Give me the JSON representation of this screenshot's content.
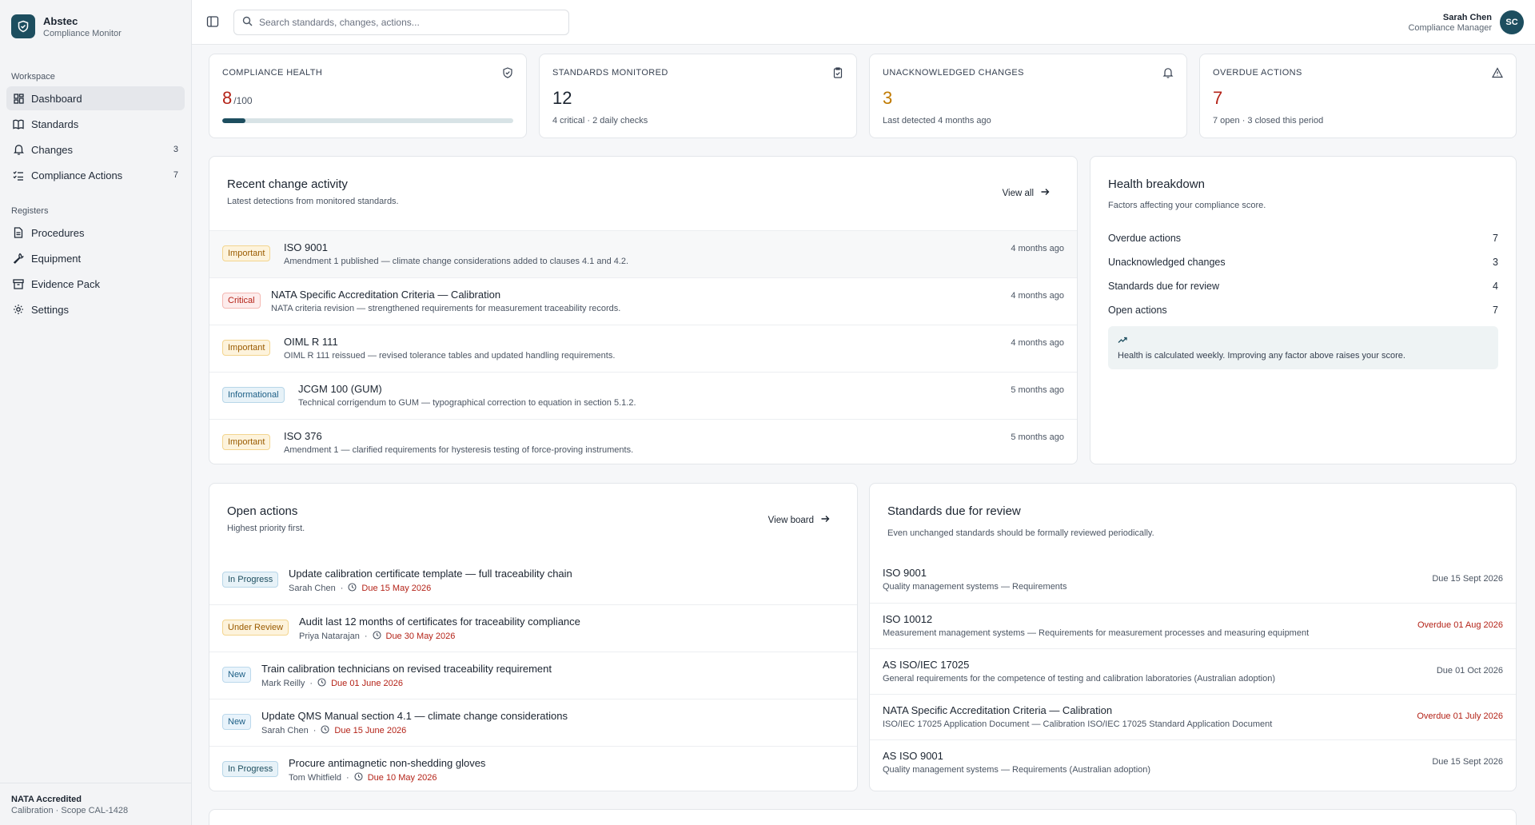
{
  "brand": {
    "name": "Abstec",
    "subtitle": "Compliance Monitor"
  },
  "sidebar": {
    "workspace_label": "Workspace",
    "workspace_items": [
      {
        "label": "Dashboard",
        "icon": "dashboard-icon",
        "count": ""
      },
      {
        "label": "Standards",
        "icon": "book-icon",
        "count": ""
      },
      {
        "label": "Changes",
        "icon": "bell-icon",
        "count": "3"
      },
      {
        "label": "Compliance Actions",
        "icon": "checklist-icon",
        "count": "7"
      }
    ],
    "registers_label": "Registers",
    "register_items": [
      {
        "label": "Procedures",
        "icon": "document-icon"
      },
      {
        "label": "Equipment",
        "icon": "wrench-icon"
      },
      {
        "label": "Evidence Pack",
        "icon": "archive-icon"
      },
      {
        "label": "Settings",
        "icon": "gear-icon"
      }
    ],
    "footer": {
      "title": "NATA Accredited",
      "subtitle": "Calibration · Scope CAL-1428"
    }
  },
  "search": {
    "placeholder": "Search standards, changes, actions..."
  },
  "user": {
    "name": "Sarah Chen",
    "role": "Compliance Manager",
    "initials": "SC"
  },
  "stats": {
    "health": {
      "label": "COMPLIANCE HEALTH",
      "value": "8",
      "unit": "/100",
      "progress": 0.08
    },
    "standards": {
      "label": "STANDARDS MONITORED",
      "value": "12",
      "sub": "4 critical · 2 daily checks"
    },
    "unack": {
      "label": "UNACKNOWLEDGED CHANGES",
      "value": "3",
      "sub": "Last detected 4 months ago"
    },
    "overdue": {
      "label": "OVERDUE ACTIONS",
      "value": "7",
      "sub": "7 open · 3 closed this period"
    }
  },
  "recent": {
    "title": "Recent change activity",
    "subtitle": "Latest detections from monitored standards.",
    "view_all": "View all",
    "items": [
      {
        "badge": "Important",
        "title": "ISO 9001",
        "desc": "Amendment 1 published — climate change considerations added to clauses 4.1 and 4.2.",
        "time": "4 months ago"
      },
      {
        "badge": "Critical",
        "title": "NATA Specific Accreditation Criteria — Calibration",
        "desc": "NATA criteria revision — strengthened requirements for measurement traceability records.",
        "time": "4 months ago"
      },
      {
        "badge": "Important",
        "title": "OIML R 111",
        "desc": "OIML R 111 reissued — revised tolerance tables and updated handling requirements.",
        "time": "4 months ago"
      },
      {
        "badge": "Informational",
        "title": "JCGM 100 (GUM)",
        "desc": "Technical corrigendum to GUM — typographical correction to equation in section 5.1.2.",
        "time": "5 months ago"
      },
      {
        "badge": "Important",
        "title": "ISO 376",
        "desc": "Amendment 1 — clarified requirements for hysteresis testing of force-proving instruments.",
        "time": "5 months ago"
      }
    ]
  },
  "health_breakdown": {
    "title": "Health breakdown",
    "subtitle": "Factors affecting your compliance score.",
    "rows": [
      {
        "label": "Overdue actions",
        "value": "7"
      },
      {
        "label": "Unacknowledged changes",
        "value": "3"
      },
      {
        "label": "Standards due for review",
        "value": "4"
      },
      {
        "label": "Open actions",
        "value": "7"
      }
    ],
    "note": "Health is calculated weekly. Improving any factor above raises your score."
  },
  "open_actions": {
    "title": "Open actions",
    "subtitle": "Highest priority first.",
    "view_board": "View board",
    "items": [
      {
        "badge": "In Progress",
        "title": "Update calibration certificate template — full traceability chain",
        "owner": "Sarah Chen",
        "due": "Due 15 May 2026"
      },
      {
        "badge": "Under Review",
        "title": "Audit last 12 months of certificates for traceability compliance",
        "owner": "Priya Natarajan",
        "due": "Due 30 May 2026"
      },
      {
        "badge": "New",
        "title": "Train calibration technicians on revised traceability requirement",
        "owner": "Mark Reilly",
        "due": "Due 01 June 2026"
      },
      {
        "badge": "New",
        "title": "Update QMS Manual section 4.1 — climate change considerations",
        "owner": "Sarah Chen",
        "due": "Due 15 June 2026"
      },
      {
        "badge": "In Progress",
        "title": "Procure antimagnetic non-shedding gloves",
        "owner": "Tom Whitfield",
        "due": "Due 10 May 2026"
      }
    ]
  },
  "review": {
    "title": "Standards due for review",
    "subtitle": "Even unchanged standards should be formally reviewed periodically.",
    "items": [
      {
        "title": "ISO 9001",
        "desc": "Quality management systems — Requirements",
        "due": "Due 15 Sept 2026",
        "overdue": false
      },
      {
        "title": "ISO 10012",
        "desc": "Measurement management systems — Requirements for measurement processes and measuring equipment",
        "due": "Overdue 01 Aug 2026",
        "overdue": true
      },
      {
        "title": "AS ISO/IEC 17025",
        "desc": "General requirements for the competence of testing and calibration laboratories (Australian adoption)",
        "due": "Due 01 Oct 2026",
        "overdue": false
      },
      {
        "title": "NATA Specific Accreditation Criteria — Calibration",
        "desc": "ISO/IEC 17025 Application Document — Calibration ISO/IEC 17025 Standard Application Document",
        "due": "Overdue 01 July 2026",
        "overdue": true
      },
      {
        "title": "AS ISO 9001",
        "desc": "Quality management systems — Requirements (Australian adoption)",
        "due": "Due 15 Sept 2026",
        "overdue": false
      }
    ]
  },
  "colors": {
    "accent": "#1d4e5f",
    "danger": "#b42318",
    "warning": "#c07a00"
  }
}
